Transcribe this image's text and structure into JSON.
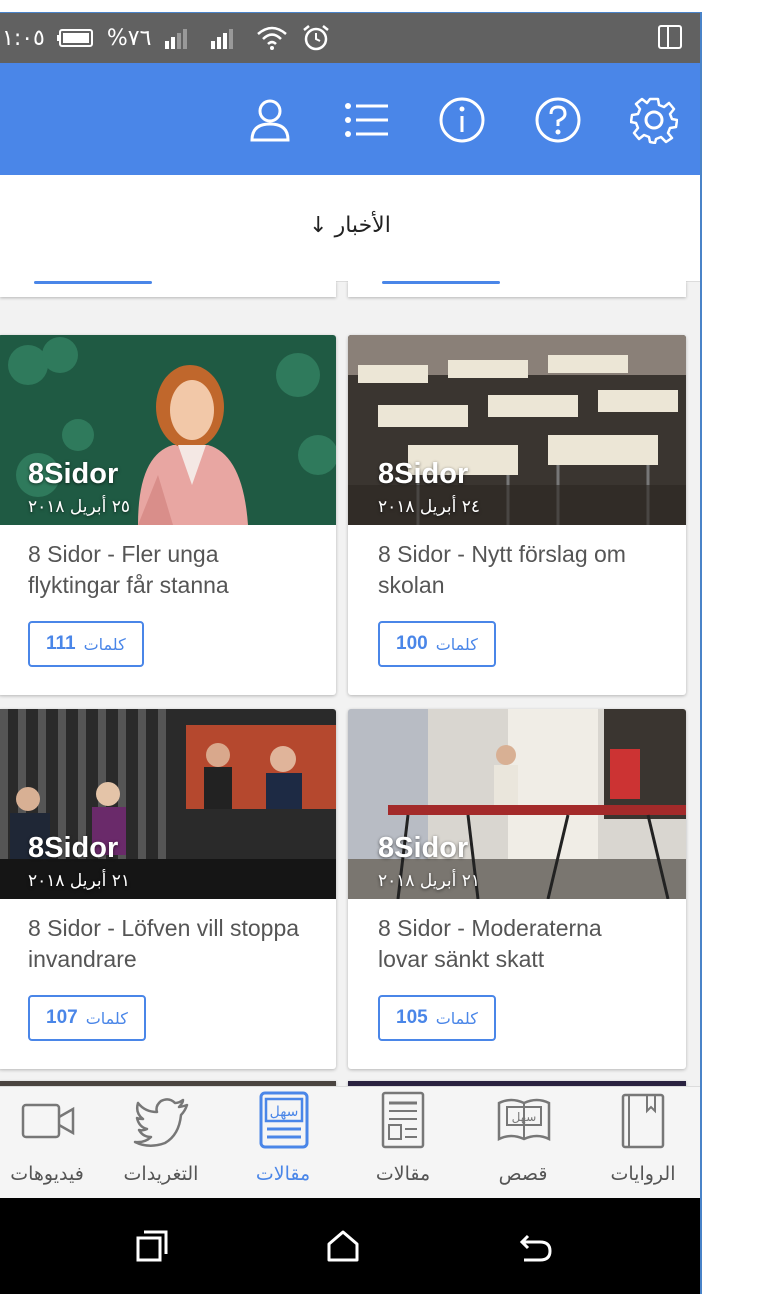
{
  "status_bar": {
    "time": "١:٠٥",
    "battery": "%٧٦"
  },
  "app_bar": {
    "icons": [
      "person-icon",
      "list-icon",
      "info-icon",
      "help-icon",
      "settings-icon"
    ]
  },
  "topic": {
    "label": "الأخبار ↓"
  },
  "articles": [
    {
      "source": "8Sidor",
      "date": "٢٥ أبريل ٢٠١٨",
      "title": "8 Sidor - Fler unga flyktingar får stanna",
      "words_count": "111",
      "words_label": "كلمات"
    },
    {
      "source": "8Sidor",
      "date": "٢٤ أبريل ٢٠١٨",
      "title": "8 Sidor - Nytt förslag om skolan",
      "words_count": "100",
      "words_label": "كلمات"
    },
    {
      "source": "8Sidor",
      "date": "٢١ أبريل ٢٠١٨",
      "title": "8 Sidor - Löfven vill stoppa invandrare",
      "words_count": "107",
      "words_label": "كلمات"
    },
    {
      "source": "8Sidor",
      "date": "٢١ أبريل ٢٠١٨",
      "title": "8 Sidor - Moderaterna lovar sänkt skatt",
      "words_count": "105",
      "words_label": "كلمات"
    }
  ],
  "bottom_nav": [
    {
      "label": "فيديوهات",
      "icon": "video-icon"
    },
    {
      "label": "التغريدات",
      "icon": "twitter-icon"
    },
    {
      "label": "مقالات",
      "icon": "easy-articles-icon",
      "active": true
    },
    {
      "label": "مقالات",
      "icon": "newspaper-icon"
    },
    {
      "label": "قصص",
      "icon": "book-open-icon"
    },
    {
      "label": "الروايات",
      "icon": "book-icon"
    }
  ],
  "icon_badges": {
    "easy_label": "سهل"
  },
  "colors": {
    "accent": "#4a86e8",
    "status_bar": "#616161",
    "background": "#f2f2f2"
  }
}
